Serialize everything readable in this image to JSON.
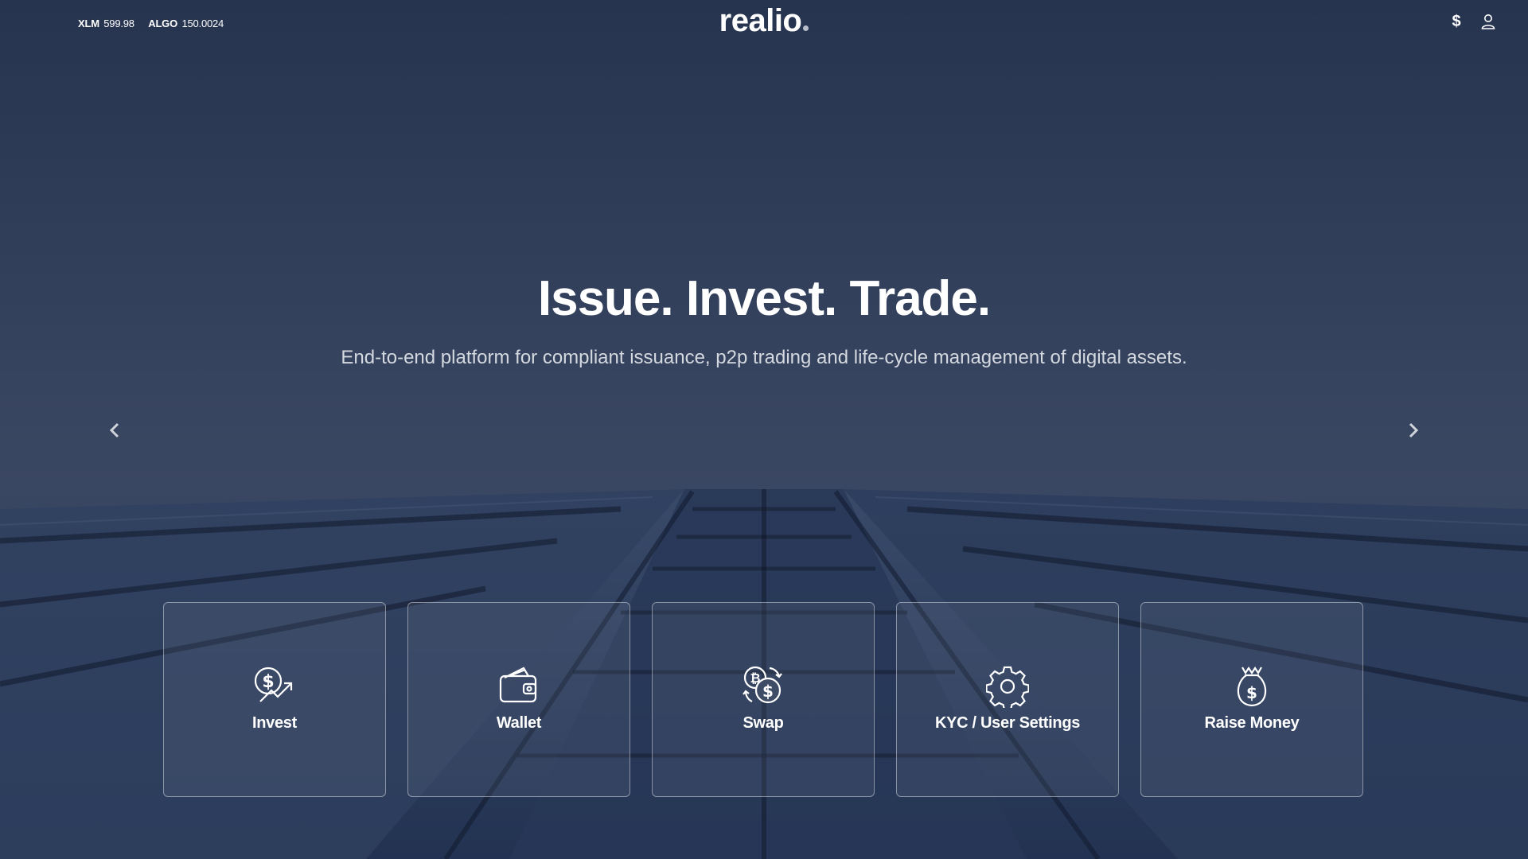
{
  "header": {
    "tickers": [
      {
        "symbol": "XLM",
        "value": "599.98"
      },
      {
        "symbol": "ALGO",
        "value": "150.0024"
      }
    ],
    "logo": "realio",
    "currency_icon": "dollar-icon",
    "user_icon": "user-icon"
  },
  "hero": {
    "title": "Issue. Invest. Trade.",
    "subtitle": "End-to-end platform for compliant issuance, p2p trading and life-cycle management of digital assets.",
    "prev_icon": "chevron-left-icon",
    "next_icon": "chevron-right-icon"
  },
  "cards": [
    {
      "label": "Invest",
      "icon": "invest-icon"
    },
    {
      "label": "Wallet",
      "icon": "wallet-icon"
    },
    {
      "label": "Swap",
      "icon": "swap-icon"
    },
    {
      "label": "KYC / User Settings",
      "icon": "gear-icon"
    },
    {
      "label": "Raise Money",
      "icon": "money-bag-icon"
    }
  ],
  "colors": {
    "background_top": "#2e3a56",
    "background_bottom": "#1f2c47",
    "text": "#ffffff",
    "subtitle_text": "#d4d8df"
  }
}
